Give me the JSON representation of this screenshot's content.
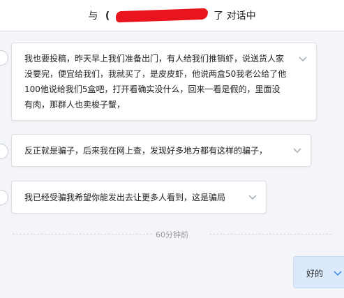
{
  "header": {
    "prefix": "与",
    "obscured_char": "(",
    "suffix": "了 对话中"
  },
  "messages": [
    {
      "text": "我也要投稿，昨天早上我们准备出门，有人给我们推销虾，说送货人家没要完，便宜给我们，我就买了，是皮皮虾，他说两盒50我老公给了他100他说给我们5盒吧，打开看确实没什么，回来一看是假的，里面没有肉，那群人也卖梭子蟹，"
    },
    {
      "text": "反正就是骗子，后来我在网上查，发现好多地方都有这样的骗子，"
    },
    {
      "text": "我已经受骗我希望你能发出去让更多人看到，这是骗局"
    }
  ],
  "timestamp": "60分钟前",
  "reply": {
    "text": "好的"
  },
  "icons": {
    "expand": "chevron-down-icon"
  },
  "colors": {
    "redaction": "#e8141e",
    "reply_bg": "#dbe9fb",
    "chevron": "#a9b1bc"
  }
}
